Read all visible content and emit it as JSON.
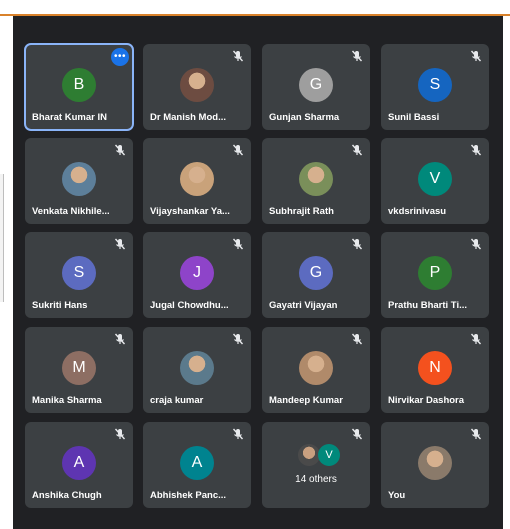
{
  "participants": [
    {
      "name": "Bharat Kumar IN",
      "initial": "B",
      "color": "#2e7d32",
      "photo": false,
      "active": true
    },
    {
      "name": "Dr Manish Mod...",
      "initial": "",
      "color": "#6d4c41",
      "photo": true
    },
    {
      "name": "Gunjan Sharma",
      "initial": "G",
      "color": "#9e9e9e",
      "photo": false
    },
    {
      "name": "Sunil Bassi",
      "initial": "S",
      "color": "#1565c0",
      "photo": false
    },
    {
      "name": "Venkata Nikhile...",
      "initial": "",
      "color": "#5d7f9a",
      "photo": true
    },
    {
      "name": "Vijayshankar Ya...",
      "initial": "",
      "color": "#c9a27a",
      "photo": true
    },
    {
      "name": "Subhrajit Rath",
      "initial": "",
      "color": "#7a8f5a",
      "photo": true
    },
    {
      "name": "vkdsrinivasu",
      "initial": "V",
      "color": "#00897b",
      "photo": false
    },
    {
      "name": "Sukriti Hans",
      "initial": "S",
      "color": "#5c6bc0",
      "photo": false
    },
    {
      "name": "Jugal Chowdhu...",
      "initial": "J",
      "color": "#8e44c9",
      "photo": false
    },
    {
      "name": "Gayatri Vijayan",
      "initial": "G",
      "color": "#5c6bc0",
      "photo": false
    },
    {
      "name": "Prathu Bharti Ti...",
      "initial": "P",
      "color": "#2e7d32",
      "photo": false
    },
    {
      "name": "Manika Sharma",
      "initial": "M",
      "color": "#8d6e63",
      "photo": false
    },
    {
      "name": "craja kumar",
      "initial": "",
      "color": "#5b7a8c",
      "photo": true
    },
    {
      "name": "Mandeep Kumar",
      "initial": "",
      "color": "#b08a6a",
      "photo": true
    },
    {
      "name": "Nirvikar Dashora",
      "initial": "N",
      "color": "#f4511e",
      "photo": false
    },
    {
      "name": "Anshika Chugh",
      "initial": "A",
      "color": "#5e35b1",
      "photo": false
    },
    {
      "name": "Abhishek Panc...",
      "initial": "A",
      "color": "#00838f",
      "photo": false
    },
    {
      "name": "14 others",
      "initial": "V",
      "color": "#00897b",
      "photo": false,
      "others": true
    },
    {
      "name": "You",
      "initial": "",
      "color": "#8a7a6a",
      "photo": true
    }
  ],
  "icons": {
    "mute": "mic-off-icon",
    "more": "more-options-icon"
  }
}
